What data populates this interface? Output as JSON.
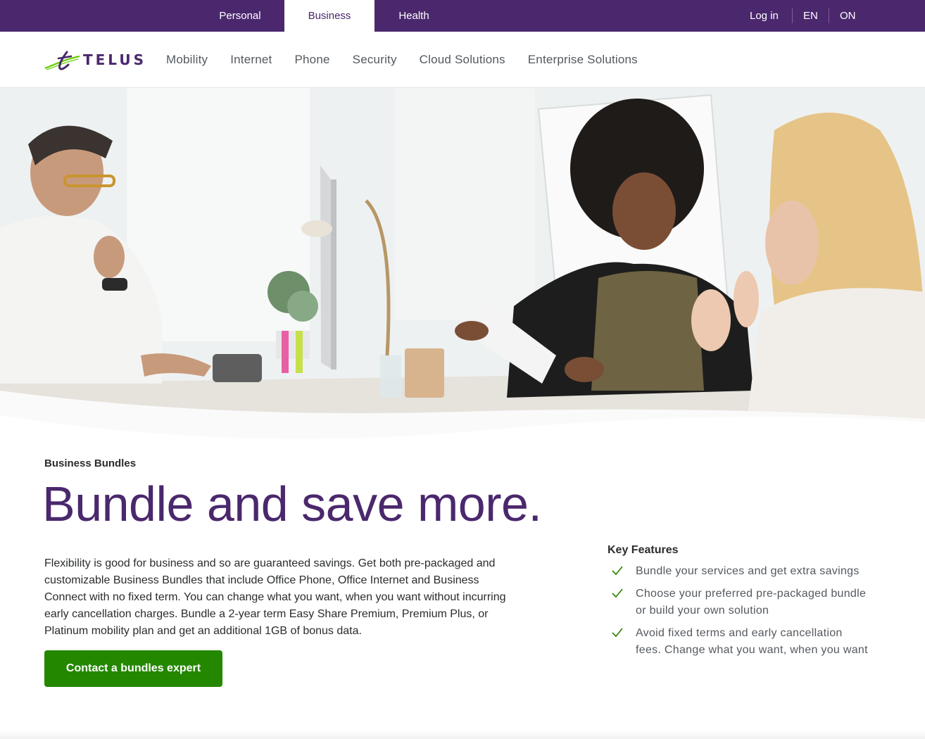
{
  "topbar": {
    "segments": [
      {
        "label": "Personal"
      },
      {
        "label": "Business"
      },
      {
        "label": "Health"
      }
    ],
    "login_label": "Log in",
    "language_label": "EN",
    "region_label": "ON"
  },
  "logo": {
    "text": "TELUS"
  },
  "nav": {
    "items": [
      {
        "label": "Mobility"
      },
      {
        "label": "Internet"
      },
      {
        "label": "Phone"
      },
      {
        "label": "Security"
      },
      {
        "label": "Cloud Solutions"
      },
      {
        "label": "Enterprise Solutions"
      }
    ]
  },
  "main": {
    "eyebrow": "Business Bundles",
    "headline": "Bundle and save more.",
    "body": "Flexibility is good for business and so are guaranteed savings. Get both pre-packaged and customizable Business Bundles that include Office Phone, Office Internet and Business Connect with no fixed term. You can change what you want, when you want without incurring early cancellation charges. Bundle a 2-year term Easy Share Premium, Premium Plus, or Platinum mobility plan and get an additional 1GB of bonus data.",
    "cta_label": "Contact a bundles expert"
  },
  "key_features": {
    "title": "Key Features",
    "items": [
      {
        "text": "Bundle your services and get extra savings"
      },
      {
        "text": "Choose your preferred pre-packaged bundle or build your own solution"
      },
      {
        "text": "Avoid fixed terms and early cancellation fees. Change what you want, when you want"
      }
    ]
  },
  "colors": {
    "brand_purple": "#4b286d",
    "cta_green": "#248700",
    "check_green": "#2b8000"
  }
}
